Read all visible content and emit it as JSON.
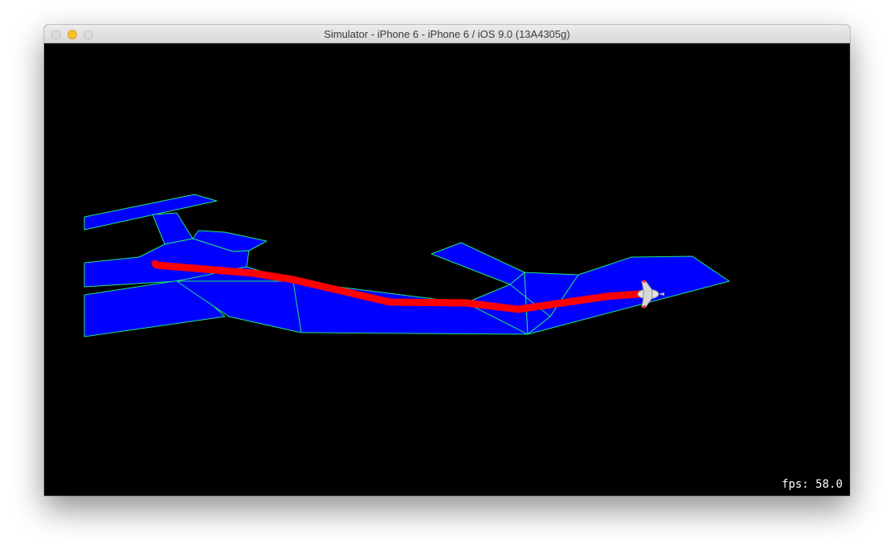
{
  "window": {
    "title": "Simulator - iPhone 6 - iPhone 6 / iOS 9.0 (13A4305g)"
  },
  "scene": {
    "navmesh_fill": "#0000ff",
    "navmesh_edge": "#1ee67a",
    "path_color": "#ff0000",
    "agent_icon": "spaceship-icon"
  },
  "overlay": {
    "fps_text": "fps: 58.0"
  }
}
